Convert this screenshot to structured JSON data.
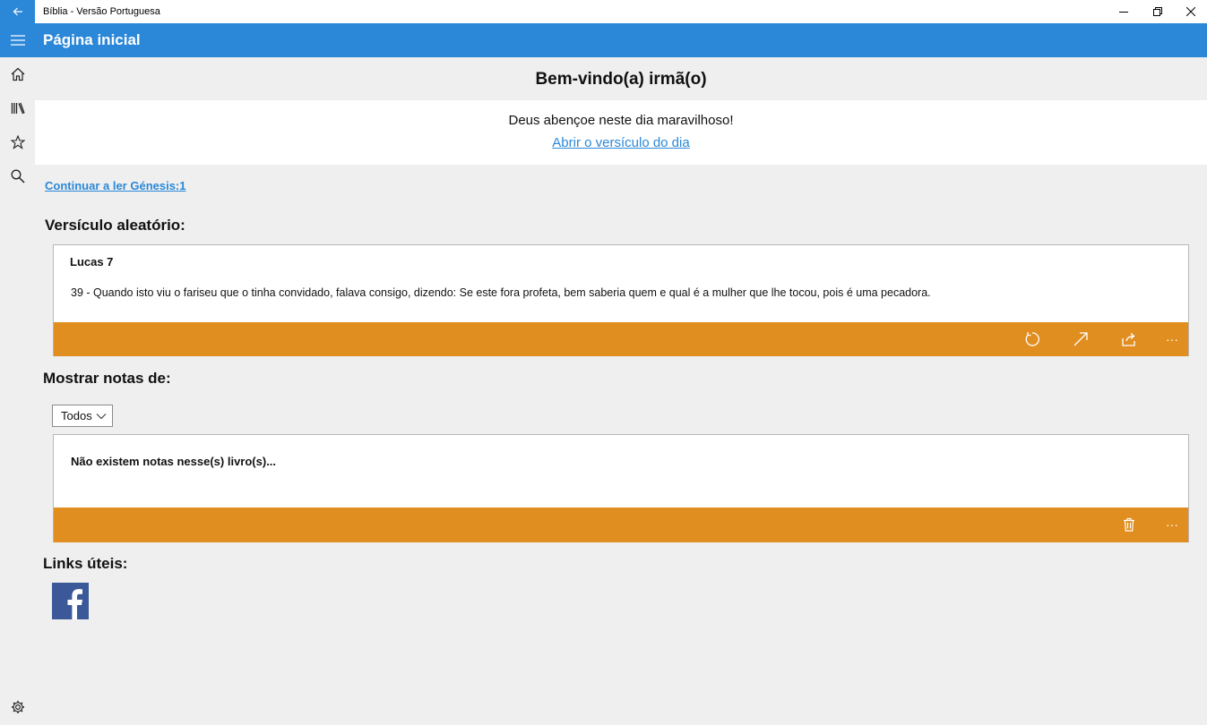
{
  "window": {
    "title": "Bíblia - Versão Portuguesa"
  },
  "header": {
    "page_title": "Página inicial"
  },
  "sidebar": {
    "items": [
      {
        "icon": "home-icon"
      },
      {
        "icon": "library-icon"
      },
      {
        "icon": "star-icon"
      },
      {
        "icon": "search-icon"
      }
    ],
    "footer_icon": "gear-icon"
  },
  "main": {
    "welcome": "Bem-vindo(a) irmã(o)",
    "blessing": "Deus abençoe neste dia maravilhoso!",
    "verse_of_day_link": "Abrir o versículo do dia",
    "continue_reading": "Continuar a ler Génesis:1",
    "random_verse": {
      "label": "Versículo aleatório:",
      "reference": "Lucas 7",
      "text": "39 - Quando isto viu o fariseu que o tinha convidado, falava consigo, dizendo: Se este fora profeta, bem saberia quem e qual é a mulher que lhe tocou, pois é uma pecadora.",
      "more": "···"
    },
    "notes": {
      "label": "Mostrar notas de:",
      "filter_value": "Todos",
      "empty_message": "Não existem notas nesse(s) livro(s)...",
      "more": "···"
    },
    "links": {
      "label": "Links úteis:"
    }
  },
  "colors": {
    "accent": "#2b88d8",
    "card_bar": "#e08e20",
    "facebook": "#3b5998"
  }
}
